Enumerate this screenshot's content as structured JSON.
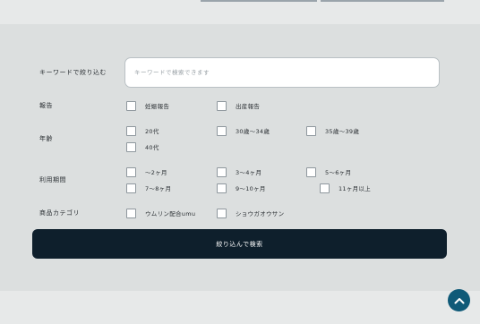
{
  "keyword": {
    "label": "キーワードで絞り込む",
    "placeholder": "キーワードで検索できます",
    "value": ""
  },
  "filters": [
    {
      "label": "報告",
      "options": [
        "妊娠報告",
        "出産報告"
      ]
    },
    {
      "label": "年齢",
      "options": [
        "20代",
        "30歳〜34歳",
        "35歳〜39歳",
        "40代"
      ]
    },
    {
      "label": "利用期間",
      "options": [
        "〜2ヶ月",
        "3〜4ヶ月",
        "5〜6ヶ月",
        "7〜8ヶ月",
        "9〜10ヶ月",
        "11ヶ月以上"
      ]
    },
    {
      "label": "商品カテゴリ",
      "options": [
        "ウムリン配合umu",
        "ショウガオウサン"
      ]
    }
  ],
  "submit_label": "絞り込んで検索",
  "icons": {
    "scroll_top": "chevron-up-icon"
  },
  "colors": {
    "accent": "#0f5a78",
    "button": "#0e1f2c",
    "background": "#dcdfdf"
  }
}
